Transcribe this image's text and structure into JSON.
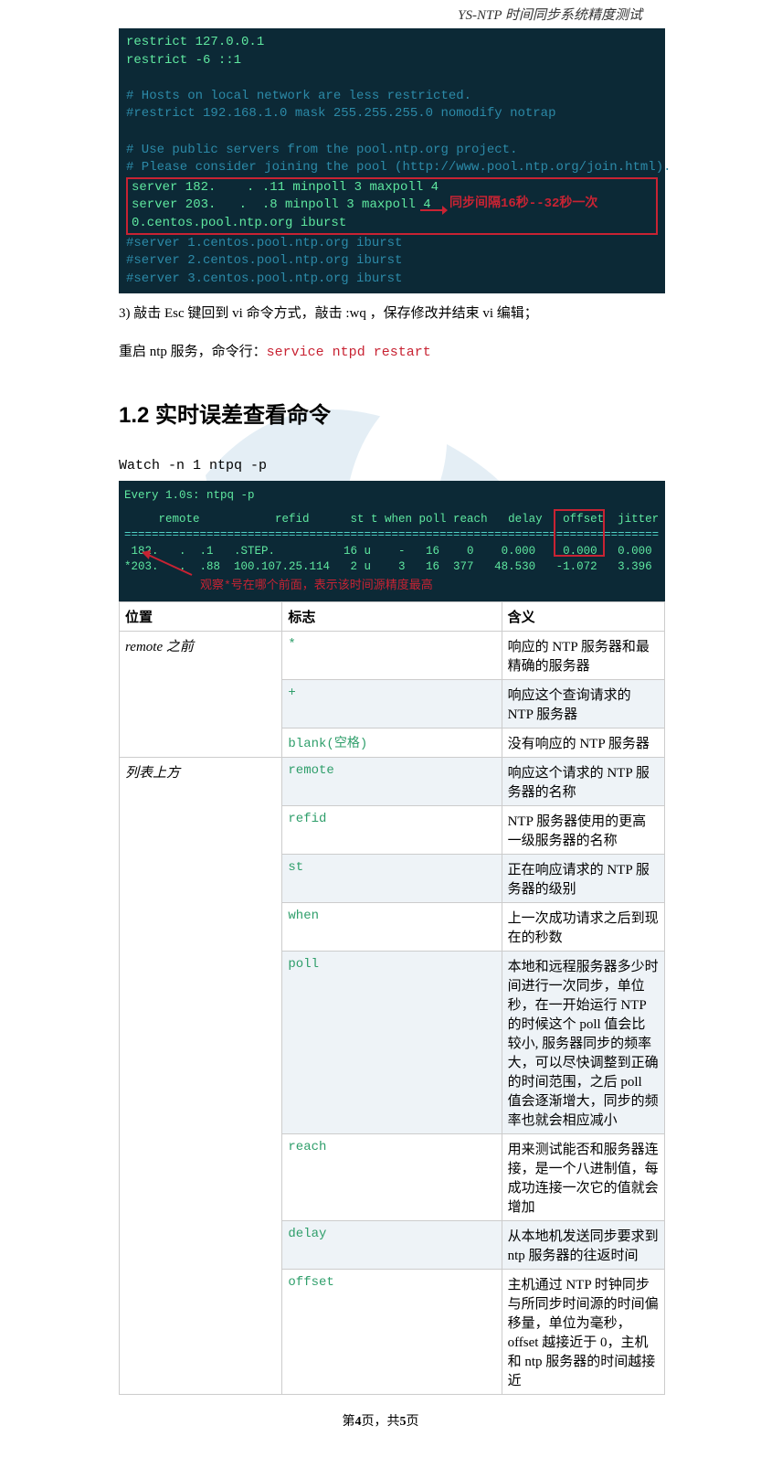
{
  "header": {
    "title": "YS-NTP 时间同步系统精度测试"
  },
  "terminal1": {
    "lines_top": [
      {
        "cls": "term-bright",
        "t": "restrict 127.0.0.1"
      },
      {
        "cls": "term-bright",
        "t": "restrict -6 ::1"
      },
      {
        "cls": "",
        "t": " "
      },
      {
        "cls": "term-comment",
        "t": "# Hosts on local network are less restricted."
      },
      {
        "cls": "term-comment",
        "t": "#restrict 192.168.1.0 mask 255.255.255.0 nomodify notrap"
      },
      {
        "cls": "",
        "t": " "
      },
      {
        "cls": "term-comment",
        "t": "# Use public servers from the pool.ntp.org project."
      },
      {
        "cls": "term-comment",
        "t": "# Please consider joining the pool (http://www.pool.ntp.org/join.html)."
      }
    ],
    "boxed": [
      "server 182.    . .11 minpoll 3 maxpoll 4",
      "server 203.   .  .8 minpoll 3 maxpoll 4",
      "0.centos.pool.ntp.org iburst"
    ],
    "lines_after": [
      "#server 1.centos.pool.ntp.org iburst",
      "#server 2.centos.pool.ntp.org iburst",
      "#server 3.centos.pool.ntp.org iburst"
    ],
    "arrow_label": "同步间隔16秒--32秒一次"
  },
  "desc1": {
    "prefix": "3) 敲击 Esc 键回到 vi 命令方式，敲击 :wq ，保存修改并结束 vi 编辑；"
  },
  "desc2": {
    "prefix": "重启 ntp 服务，命令行：",
    "cmd": "service ntpd restart"
  },
  "section": "1.2 实时误差查看命令",
  "cmd": "Watch -n  1  ntpq  -p",
  "terminal2": {
    "head": "Every 1.0s: ntpq -p",
    "columns": "     remote           refid      st t when poll reach   delay   offset  jitter",
    "eq": "==============================================================================",
    "rows": [
      " 182.   .  .1   .STEP.          16 u    -   16    0    0.000    0.000   0.000",
      "*203.   .  .88  100.107.25.114   2 u    3   16  377   48.530   -1.072   3.396"
    ],
    "offset_box_values": [
      "offset",
      "0.000",
      "-1.072"
    ],
    "hint": "观察*号在哪个前面，表示该时间源精度最高"
  },
  "table": {
    "headers": [
      "位置",
      "标志",
      "含义"
    ],
    "groups": [
      {
        "rowhead": "remote 之前",
        "rows": [
          {
            "flag": "*",
            "desc": "响应的 NTP 服务器和最精确的服务器",
            "alt": false
          },
          {
            "flag": "+",
            "desc": "响应这个查询请求的 NTP 服务器",
            "alt": true
          },
          {
            "flag": "blank(空格)",
            "desc": "没有响应的 NTP 服务器",
            "alt": false
          }
        ]
      },
      {
        "rowhead": "列表上方",
        "rows": [
          {
            "flag": "remote",
            "desc": "响应这个请求的 NTP 服务器的名称",
            "alt": true
          },
          {
            "flag": "refid",
            "desc": "NTP 服务器使用的更高一级服务器的名称",
            "alt": false
          },
          {
            "flag": "st",
            "desc": "正在响应请求的 NTP 服务器的级别",
            "alt": true
          },
          {
            "flag": "when",
            "desc": "上一次成功请求之后到现在的秒数",
            "alt": false
          },
          {
            "flag": "poll",
            "desc": "本地和远程服务器多少时间进行一次同步，单位秒，在一开始运行 NTP 的时候这个 poll 值会比较小, 服务器同步的频率大，可以尽快调整到正确的时间范围，之后 poll 值会逐渐增大，同步的频率也就会相应减小",
            "alt": true
          },
          {
            "flag": "reach",
            "desc": "用来测试能否和服务器连接，是一个八进制值，每成功连接一次它的值就会增加",
            "alt": false
          },
          {
            "flag": "delay",
            "desc": "从本地机发送同步要求到 ntp 服务器的往返时间",
            "alt": true
          },
          {
            "flag": "offset",
            "desc": "主机通过 NTP 时钟同步与所同步时间源的时间偏移量，单位为毫秒，offset 越接近于 0，主机和 ntp 服务器的时间越接近",
            "alt": false
          }
        ]
      }
    ]
  },
  "footer": {
    "p1": "第",
    "page": "4",
    "p2": "页，共",
    "total": "5",
    "p3": "页"
  }
}
